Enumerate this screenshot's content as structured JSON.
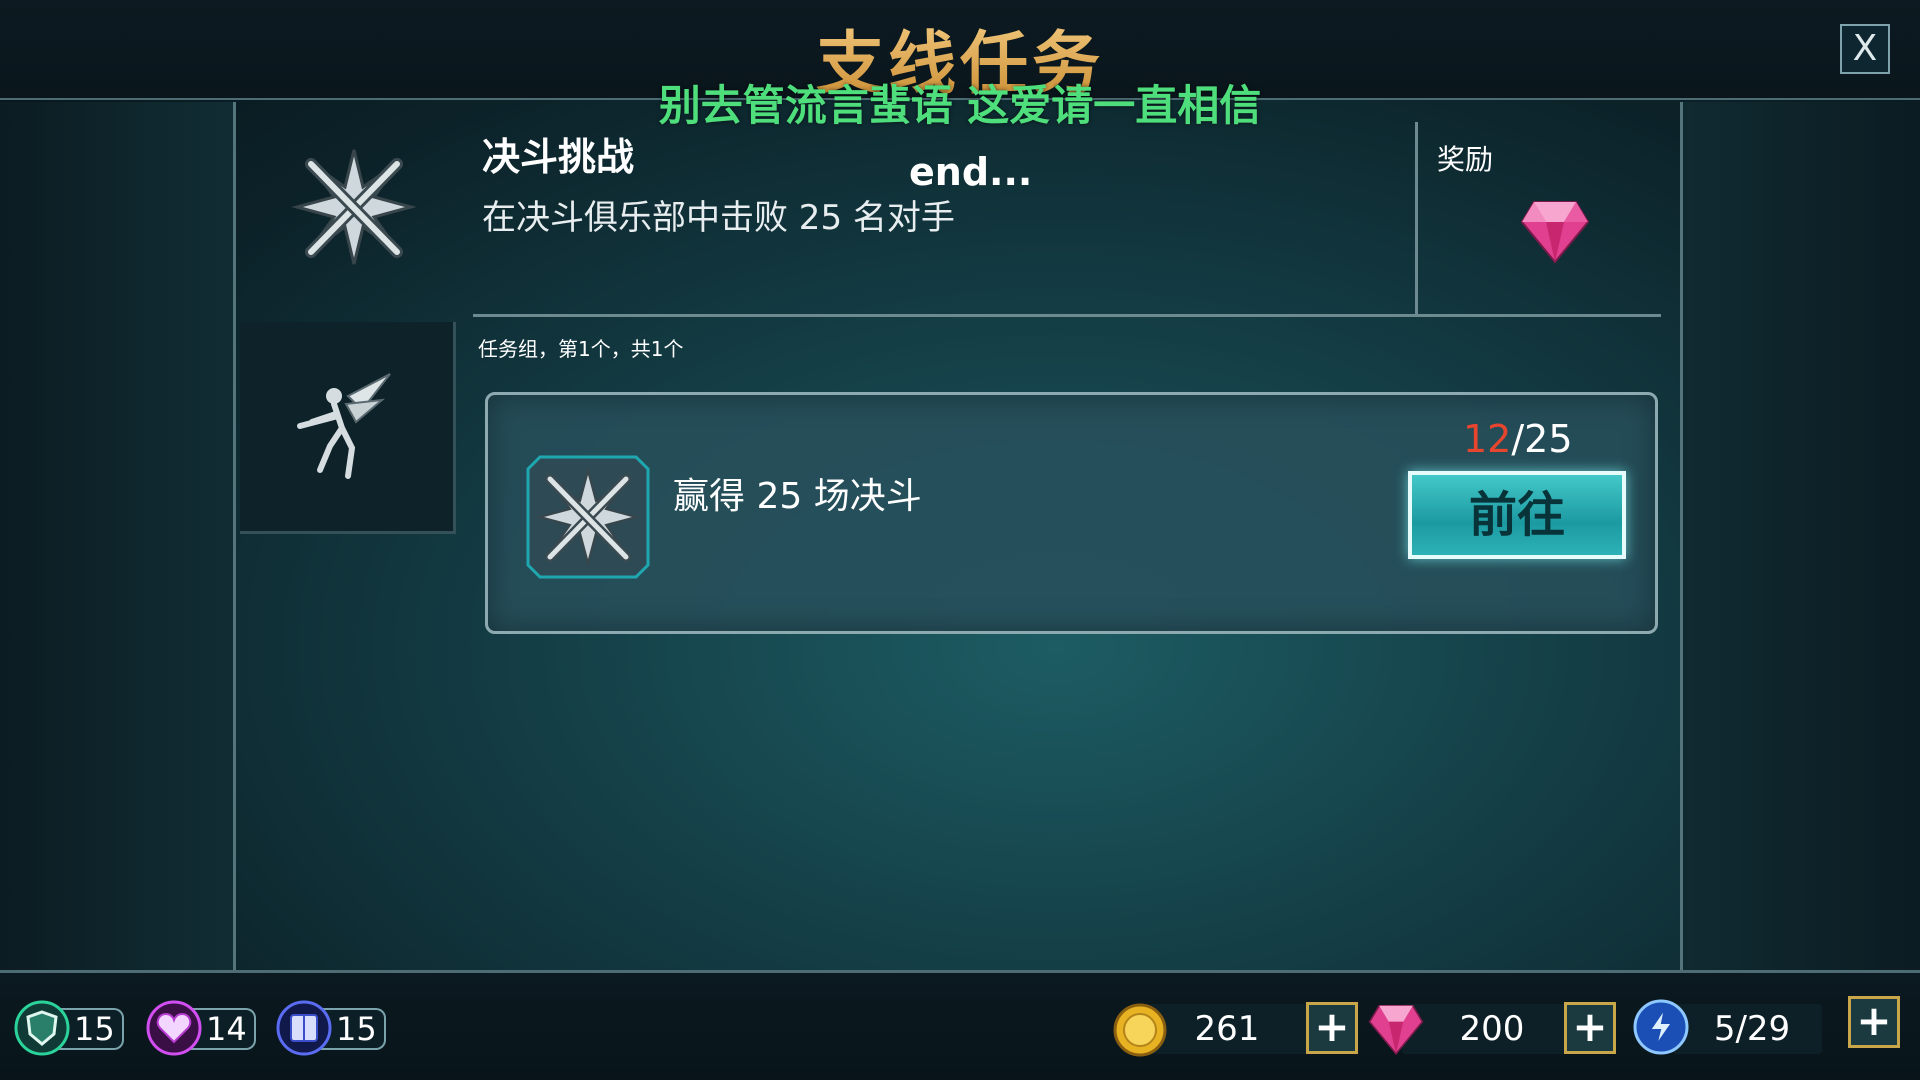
{
  "window": {
    "title": "支线任务",
    "subtitle": "别去管流言蜚语 这爱请一直相信",
    "close_label": "X"
  },
  "quest": {
    "name": "决斗挑战",
    "description": "在决斗俱乐部中击败 25 名对手",
    "overlay_text": "end...",
    "reward_label": "奖励",
    "reward_icon": "gem-icon",
    "icon": "crossed-wands-icon"
  },
  "task_group": {
    "label": "任务组，第1个，共1个",
    "tab_icon": "fairy-icon"
  },
  "task": {
    "text": "赢得 25 场决斗",
    "progress_current": "12",
    "progress_total": "/25",
    "go_label": "前往",
    "icon": "crossed-wands-icon"
  },
  "stats": [
    {
      "icon": "shield-icon",
      "value": "15",
      "color": "#1fae7d"
    },
    {
      "icon": "heart-icon",
      "value": "14",
      "color": "#b63bd0"
    },
    {
      "icon": "book-icon",
      "value": "15",
      "color": "#3a4fc9"
    }
  ],
  "resources": {
    "coins": "261",
    "gems": "200",
    "energy": "5/29",
    "plus_label": "+"
  },
  "colors": {
    "title": "#e3a64c",
    "subtitle": "#4fde7c",
    "progress_current": "#e8452e",
    "go_button": "#2cb2b6"
  }
}
